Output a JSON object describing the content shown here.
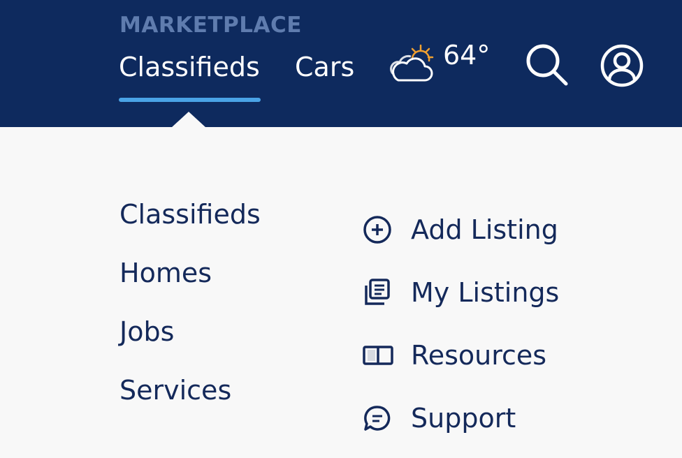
{
  "header": {
    "section_label": "MARKETPLACE",
    "tabs": [
      {
        "label": "Classifieds",
        "active": true
      },
      {
        "label": "Cars",
        "active": false
      }
    ],
    "weather": {
      "temperature": "64°",
      "icon": "partly-cloudy-icon"
    },
    "actions": [
      {
        "name": "search",
        "icon": "search-icon"
      },
      {
        "name": "account",
        "icon": "user-icon"
      }
    ]
  },
  "dropdown": {
    "categories": [
      "Classifieds",
      "Homes",
      "Jobs",
      "Services"
    ],
    "actions": [
      {
        "label": "Add Listing",
        "icon": "plus-circle-icon"
      },
      {
        "label": "My Listings",
        "icon": "listings-icon"
      },
      {
        "label": "Resources",
        "icon": "book-icon"
      },
      {
        "label": "Support",
        "icon": "chat-icon"
      }
    ]
  },
  "colors": {
    "header_bg": "#0e2a5e",
    "section_label": "#5f7cae",
    "active_underline": "#4aa3e6",
    "menu_bg": "#f8f8f8",
    "menu_text": "#14295a",
    "sun": "#f0a030"
  }
}
